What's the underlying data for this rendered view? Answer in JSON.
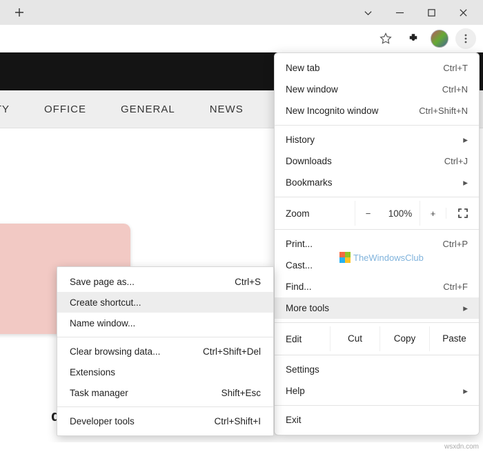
{
  "titlebar": {},
  "nav": {
    "item1": "URITY",
    "item2": "OFFICE",
    "item3": "GENERAL",
    "item4": "NEWS"
  },
  "headline": "downloading Offline Address",
  "menu": {
    "new_tab": "New tab",
    "new_tab_sc": "Ctrl+T",
    "new_window": "New window",
    "new_window_sc": "Ctrl+N",
    "new_incognito": "New Incognito window",
    "new_incognito_sc": "Ctrl+Shift+N",
    "history": "History",
    "downloads": "Downloads",
    "downloads_sc": "Ctrl+J",
    "bookmarks": "Bookmarks",
    "zoom_label": "Zoom",
    "zoom_pct": "100%",
    "print": "Print...",
    "print_sc": "Ctrl+P",
    "cast": "Cast...",
    "find": "Find...",
    "find_sc": "Ctrl+F",
    "more_tools": "More tools",
    "edit": "Edit",
    "cut": "Cut",
    "copy": "Copy",
    "paste": "Paste",
    "settings": "Settings",
    "help": "Help",
    "exit": "Exit"
  },
  "submenu": {
    "save_page": "Save page as...",
    "save_page_sc": "Ctrl+S",
    "create_shortcut": "Create shortcut...",
    "name_window": "Name window...",
    "clear_data": "Clear browsing data...",
    "clear_data_sc": "Ctrl+Shift+Del",
    "extensions": "Extensions",
    "task_manager": "Task manager",
    "task_manager_sc": "Shift+Esc",
    "dev_tools": "Developer tools",
    "dev_tools_sc": "Ctrl+Shift+I"
  },
  "watermark": "TheWindowsClub",
  "credit": "wsxdn.com"
}
